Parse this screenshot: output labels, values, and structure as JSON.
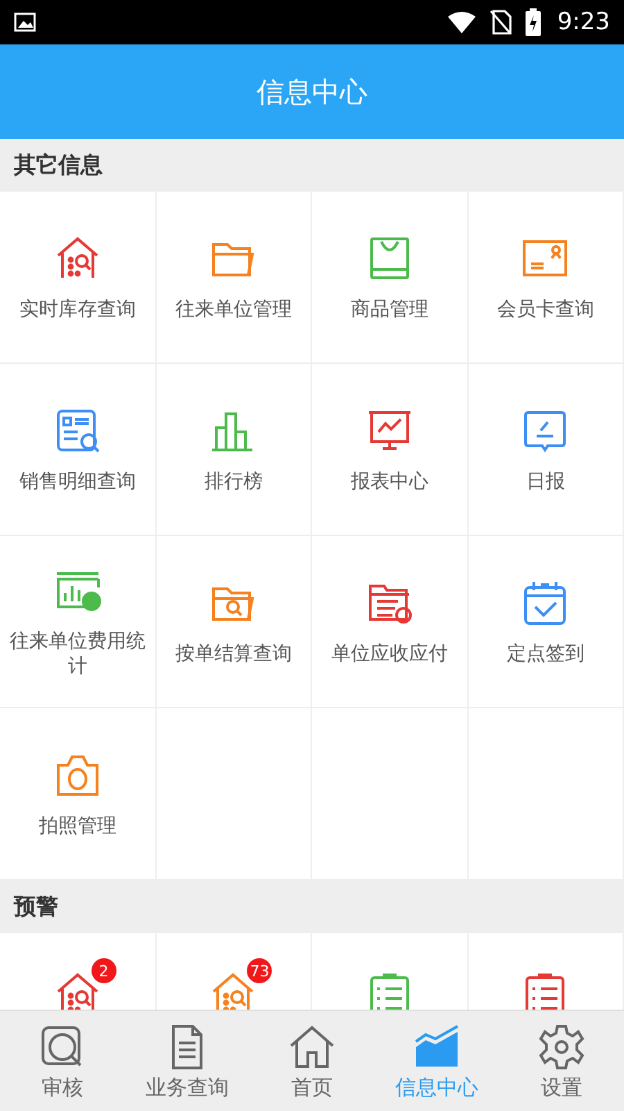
{
  "status_bar": {
    "time": "9:23"
  },
  "header": {
    "title": "信息中心"
  },
  "sections": [
    {
      "title": "其它信息",
      "items": [
        {
          "label": "实时库存查询",
          "kind": "warehouse",
          "color": "#e53935"
        },
        {
          "label": "往来单位管理",
          "kind": "folder",
          "color": "#f5821f"
        },
        {
          "label": "商品管理",
          "kind": "bag",
          "color": "#4cbb4c"
        },
        {
          "label": "会员卡查询",
          "kind": "card",
          "color": "#f5821f"
        },
        {
          "label": "销售明细查询",
          "kind": "report",
          "color": "#3d8ff5"
        },
        {
          "label": "排行榜",
          "kind": "bars",
          "color": "#4cbb4c"
        },
        {
          "label": "报表中心",
          "kind": "board",
          "color": "#e53935"
        },
        {
          "label": "日报",
          "kind": "note",
          "color": "#3d8ff5"
        },
        {
          "label": "往来单位费用统计",
          "kind": "stats",
          "color": "#4cbb4c"
        },
        {
          "label": "按单结算查询",
          "kind": "folder-search",
          "color": "#f5821f"
        },
        {
          "label": "单位应收应付",
          "kind": "list-folder",
          "color": "#e53935"
        },
        {
          "label": "定点签到",
          "kind": "calendar",
          "color": "#3d8ff5"
        },
        {
          "label": "拍照管理",
          "kind": "camera",
          "color": "#f5821f"
        }
      ]
    },
    {
      "title": "预警",
      "items": [
        {
          "kind": "warehouse",
          "color": "#e53935",
          "badge": "2"
        },
        {
          "kind": "warehouse",
          "color": "#f5821f",
          "badge": "73"
        },
        {
          "kind": "checklist",
          "color": "#4cbb4c"
        },
        {
          "kind": "checklist",
          "color": "#e53935"
        }
      ]
    }
  ],
  "tabs": [
    {
      "label": "审核",
      "kind": "audit",
      "selected": false
    },
    {
      "label": "业务查询",
      "kind": "doc",
      "selected": false
    },
    {
      "label": "首页",
      "kind": "home",
      "selected": false
    },
    {
      "label": "信息中心",
      "kind": "chart",
      "selected": true
    },
    {
      "label": "设置",
      "kind": "gear",
      "selected": false
    }
  ]
}
